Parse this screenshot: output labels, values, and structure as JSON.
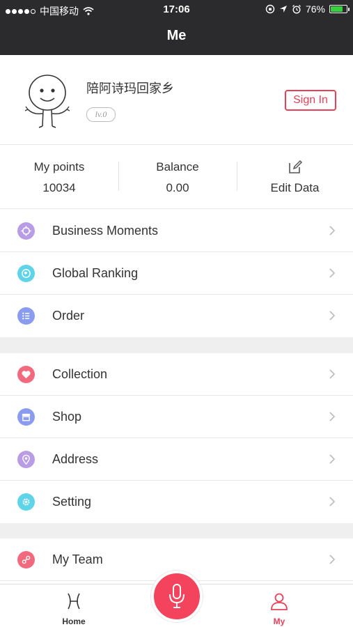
{
  "status_bar": {
    "carrier": "中国移动",
    "time": "17:06",
    "battery": "76%"
  },
  "nav": {
    "title": "Me"
  },
  "profile": {
    "username": "陪阿诗玛回家乡",
    "level": "lv.0",
    "sign_in_label": "Sign In"
  },
  "stats": {
    "points_label": "My points",
    "points_value": "10034",
    "balance_label": "Balance",
    "balance_value": "0.00",
    "edit_label": "Edit Data"
  },
  "menu": {
    "group1": [
      {
        "label": "Business Moments",
        "icon": "crosshair-icon",
        "color": "#a78bdc"
      },
      {
        "label": "Global Ranking",
        "icon": "globe-icon",
        "color": "#5fd3e8"
      },
      {
        "label": "Order",
        "icon": "list-icon",
        "color": "#8a9cf0"
      }
    ],
    "group2": [
      {
        "label": "Collection",
        "icon": "heart-icon",
        "color": "#f26a7e"
      },
      {
        "label": "Shop",
        "icon": "shop-icon",
        "color": "#8a9cf0"
      },
      {
        "label": "Address",
        "icon": "location-icon",
        "color": "#a78bdc"
      },
      {
        "label": "Setting",
        "icon": "gear-icon",
        "color": "#5fd3e8"
      }
    ],
    "group3": [
      {
        "label": "My Team",
        "icon": "link-icon",
        "color": "#f26a7e"
      }
    ]
  },
  "tabbar": {
    "home_label": "Home",
    "my_label": "My",
    "accent": "#e84157"
  }
}
